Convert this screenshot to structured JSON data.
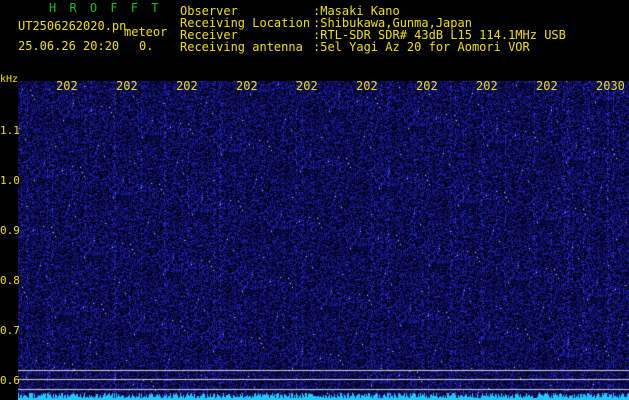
{
  "header": {
    "app_title": "H R O F F T",
    "filename": "UT2506262020.pn",
    "meteor_label": "meteor",
    "datetime": "25.06.26 20:20",
    "count": "0."
  },
  "info": [
    {
      "key": "Observer",
      "value": ":Masaki Kano"
    },
    {
      "key": "Receiving Location",
      "value": ":Shibukawa,Gunma,Japan"
    },
    {
      "key": "Receiver",
      "value": ":RTL-SDR SDR# 43dB L15 114.1MHz USB"
    },
    {
      "key": "Receiving antenna",
      "value": ":5el Yagi Az 20 for Aomori VOR"
    }
  ],
  "axis": {
    "y_unit": "kHz",
    "y_ticks": [
      "1.1",
      "1.0",
      "0.9",
      "0.8",
      "0.7",
      "0.6"
    ],
    "x_ticks": [
      "202",
      "202",
      "202",
      "202",
      "202",
      "202",
      "202",
      "202",
      "202",
      "2030"
    ]
  },
  "colors": {
    "background": "#000000",
    "text_yellow": "#f0e000",
    "title_green": "#18c018",
    "noise_blue": "#1a1aa0",
    "bright_cyan": "#20c8ff"
  }
}
